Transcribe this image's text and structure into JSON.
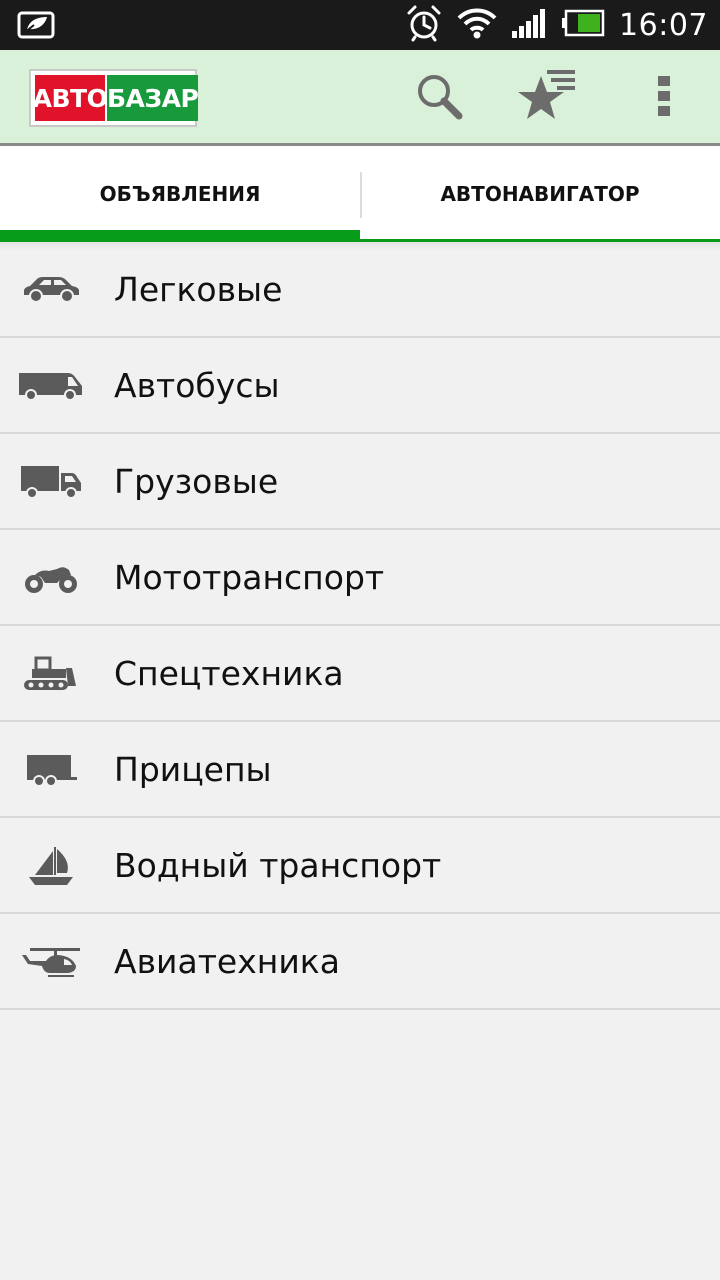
{
  "status_bar": {
    "time": "16:07",
    "icons": [
      "notification-icon",
      "alarm-icon",
      "wifi-icon",
      "signal-icon",
      "battery-icon"
    ],
    "battery_level": 0.6
  },
  "action_bar": {
    "logo_left": "АВТО",
    "logo_right": "БАЗАР",
    "actions": [
      "search-icon",
      "favorites-icon",
      "overflow-menu-icon"
    ],
    "colors": {
      "background": "#d9f1d9",
      "accent": "#079b1a",
      "logo_red": "#e0132a",
      "logo_green": "#179a3b"
    }
  },
  "tabs": [
    {
      "label": "ОБЪЯВЛЕНИЯ",
      "active": true
    },
    {
      "label": "АВТОНАВИГАТОР",
      "active": false
    }
  ],
  "categories": [
    {
      "label": "Легковые",
      "icon": "car-icon"
    },
    {
      "label": "Автобусы",
      "icon": "van-icon"
    },
    {
      "label": "Грузовые",
      "icon": "truck-icon"
    },
    {
      "label": "Мототранспорт",
      "icon": "motorcycle-icon"
    },
    {
      "label": "Спецтехника",
      "icon": "bulldozer-icon"
    },
    {
      "label": "Прицепы",
      "icon": "trailer-icon"
    },
    {
      "label": "Водный транспорт",
      "icon": "sailboat-icon"
    },
    {
      "label": "Авиатехника",
      "icon": "helicopter-icon"
    }
  ]
}
